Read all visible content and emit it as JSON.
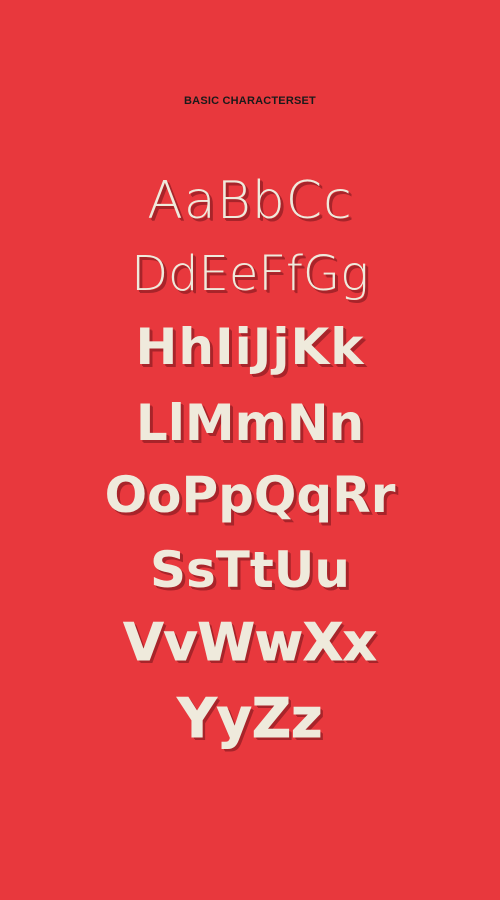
{
  "heading": "BASIC CHARACTERSET",
  "colors": {
    "background": "#e8383d",
    "letters": "#efeadc",
    "shadow": "#a8242a",
    "heading": "#1a1a1a"
  },
  "specimen_lines": [
    "AaBbCc",
    "DdEeFfGg",
    "HhIiJjKk",
    "LlMmNn",
    "OoPpQqRr",
    "SsTtUu",
    "VvWwXx",
    "YyZz"
  ]
}
